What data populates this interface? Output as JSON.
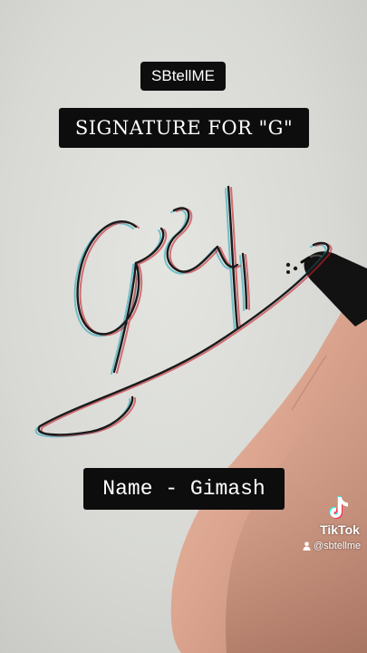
{
  "overlay": {
    "brand": "SBtellME",
    "title": "SIGNATURE FOR \"G\"",
    "name_caption": "Name - Gimash"
  },
  "watermark": {
    "logo_icon": "tiktok-logo-icon",
    "app_name": "TikTok",
    "handle": "@sbtellme"
  },
  "signature": {
    "text": "Gimash"
  },
  "colors": {
    "paper": "#d9dad6",
    "ink": "#1a1a1a",
    "ink_ghost_red": "#c8202c",
    "ink_ghost_cyan": "#1aa3b8",
    "caption_bg": "#0d0d0d",
    "caption_text": "#ffffff",
    "skin": "#d9a793"
  }
}
